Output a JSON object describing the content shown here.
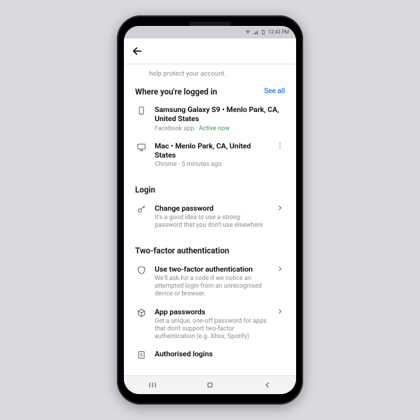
{
  "status_bar": {
    "time": "12:43 PM"
  },
  "hint_text": "help protect your account.",
  "logged_in": {
    "title": "Where you're logged in",
    "see_all": "See all",
    "sessions": [
      {
        "device": "Samsung Galaxy S9 • Menlo Park, CA, United States",
        "source": "Facebook app",
        "sep": " · ",
        "status": "Active now"
      },
      {
        "device": "Mac • Menlo Park, CA, United States",
        "source": "Chrome",
        "sep": " · ",
        "status": "5 minutes ago"
      }
    ]
  },
  "login": {
    "title": "Login",
    "change_password": {
      "title": "Change password",
      "sub": "It's a good idea to use a strong password that you don't use elsewhere"
    }
  },
  "twofa": {
    "title": "Two-factor authentication",
    "use_2fa": {
      "title": "Use two-factor authentication",
      "sub": "We'll ask for a code if we notice an attempted login from an unrecognised device or browser."
    },
    "app_passwords": {
      "title": "App passwords",
      "sub": "Get a unique, one-off password for apps that don't support two-factor authentication (e.g. Xbox, Spotify)"
    },
    "authorised_logins": {
      "title": "Authorised logins"
    }
  }
}
